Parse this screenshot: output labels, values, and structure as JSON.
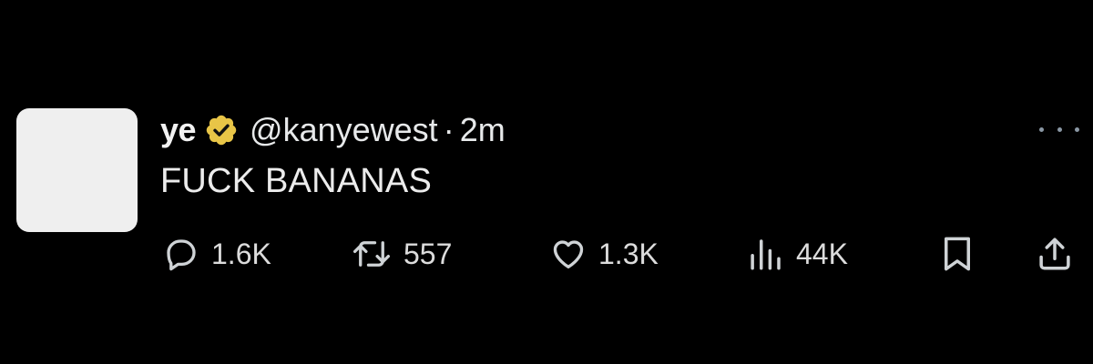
{
  "tweet": {
    "author": {
      "display_name": "ye",
      "handle": "@kanyewest",
      "verified_badge_color": "#e8c547"
    },
    "separator": "·",
    "time": "2m",
    "text": "FUCK BANANAS",
    "metrics": {
      "replies": "1.6K",
      "reposts": "557",
      "likes": "1.3K",
      "views": "44K"
    },
    "icons": {
      "reply": "speech-bubble-icon",
      "repost": "repost-arrows-icon",
      "like": "heart-icon",
      "views": "bar-chart-icon",
      "bookmark": "bookmark-icon",
      "share": "share-upload-icon",
      "more": "ellipsis-icon"
    }
  },
  "colors": {
    "background": "#000000",
    "text": "#e7e9ea",
    "icon": "#cfd3d6",
    "avatar_placeholder": "#efefef"
  }
}
